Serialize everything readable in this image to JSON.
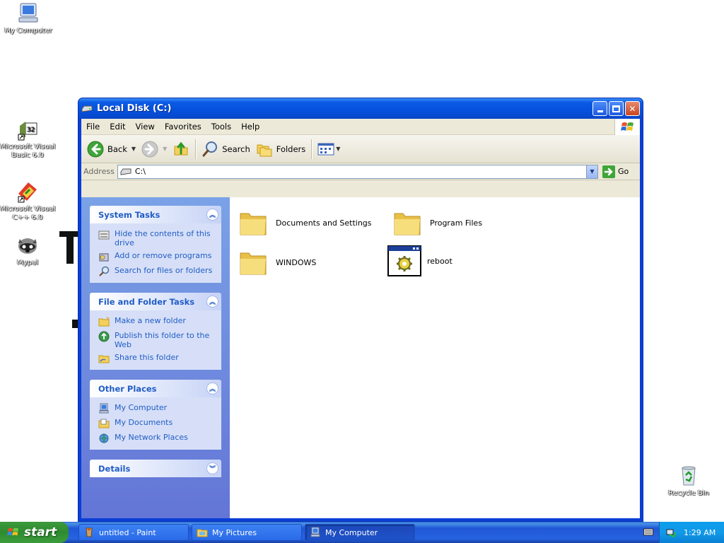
{
  "desktop": {
    "icons": [
      {
        "label": "My Computer",
        "icon": "my-computer-icon"
      },
      {
        "label": "Microsoft Visual Basic 6.0",
        "icon": "visual-basic-icon"
      },
      {
        "label": "Microsoft Visual C++ 6.0",
        "icon": "visual-cpp-icon"
      },
      {
        "label": "Mypal",
        "icon": "mypal-icon"
      },
      {
        "label": "Recycle Bin",
        "icon": "recycle-bin-icon"
      }
    ]
  },
  "window": {
    "title": "Local Disk (C:)",
    "menu": [
      "File",
      "Edit",
      "View",
      "Favorites",
      "Tools",
      "Help"
    ],
    "toolbar": {
      "back": "Back",
      "search": "Search",
      "folders": "Folders"
    },
    "address": {
      "label": "Address",
      "value": "C:\\",
      "go": "Go"
    },
    "panels": [
      {
        "title": "System Tasks",
        "tasks": [
          "Hide the contents of this drive",
          "Add or remove programs",
          "Search for files or folders"
        ]
      },
      {
        "title": "File and Folder Tasks",
        "tasks": [
          "Make a new folder",
          "Publish this folder to the Web",
          "Share this folder"
        ]
      },
      {
        "title": "Other Places",
        "tasks": [
          "My Computer",
          "My Documents",
          "My Network Places"
        ]
      },
      {
        "title": "Details",
        "tasks": []
      }
    ],
    "files": [
      {
        "name": "Documents and Settings",
        "type": "folder"
      },
      {
        "name": "Program Files",
        "type": "folder"
      },
      {
        "name": "WINDOWS",
        "type": "folder"
      },
      {
        "name": "reboot",
        "type": "program"
      }
    ]
  },
  "taskbar": {
    "start": "start",
    "buttons": [
      {
        "label": "untitled - Paint",
        "icon": "paint-icon"
      },
      {
        "label": "My Pictures",
        "icon": "my-pictures-icon"
      },
      {
        "label": "My Computer",
        "icon": "my-computer-icon"
      }
    ],
    "clock": "1:29 AM"
  },
  "colors": {
    "window_frame": "#0a3fd6",
    "taskpane_link": "#215dc6",
    "taskbar": "#2157d7",
    "start_button": "#3c9a3c"
  }
}
